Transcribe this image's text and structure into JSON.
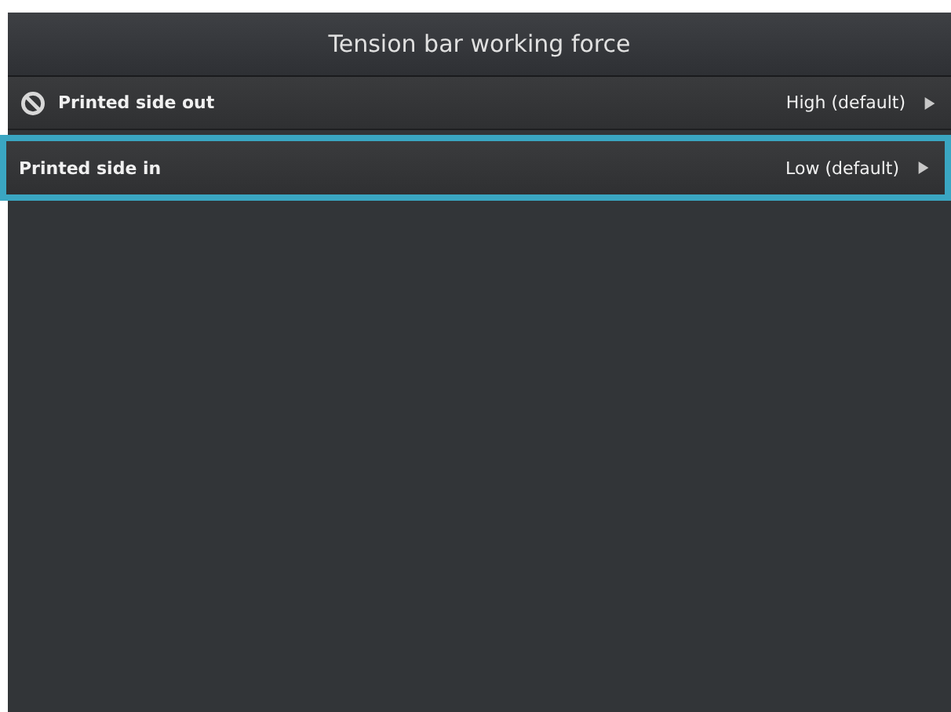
{
  "window": {
    "title": "Tension bar working force"
  },
  "options": [
    {
      "label": "Printed side out",
      "value": "High (default)",
      "blocked": true,
      "selected": false
    },
    {
      "label": "Printed side in",
      "value": "Low (default)",
      "blocked": false,
      "selected": true
    }
  ]
}
